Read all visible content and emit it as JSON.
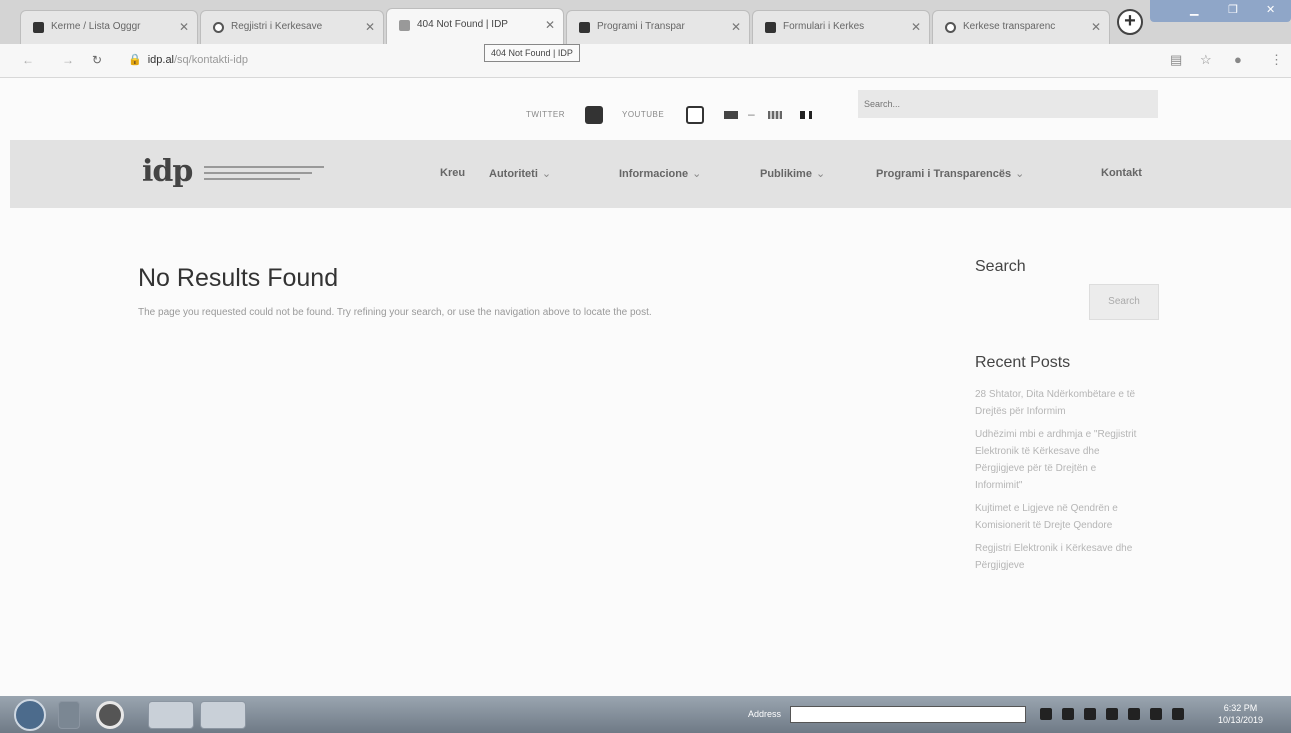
{
  "browser": {
    "tabs": [
      {
        "title": "Kerme / Lista Ogggr",
        "icon": "shield-icon"
      },
      {
        "title": "Regjistri i Kerkesave",
        "icon": "globe-icon"
      },
      {
        "title": "404 Not Found | IDP",
        "icon": "page-icon"
      },
      {
        "title": "Programi i Transpar",
        "icon": "shield-icon"
      },
      {
        "title": "Formulari i Kerkes",
        "icon": "shield-icon"
      },
      {
        "title": "Kerkese transparenc",
        "icon": "globe-icon"
      }
    ],
    "tooltip": "404 Not Found | IDP",
    "url_host": "idp.al",
    "url_path": "/sq/kontakti-idp",
    "new_tab": "+"
  },
  "site": {
    "social": {
      "twitter_label": "TWITTER",
      "youtube_label": "YOUTUBE"
    },
    "search_placeholder": "Search...",
    "nav": [
      {
        "label": "Kreu",
        "dropdown": false
      },
      {
        "label": "Autoriteti",
        "dropdown": true
      },
      {
        "label": "Informacione",
        "dropdown": true
      },
      {
        "label": "Publikime",
        "dropdown": true
      },
      {
        "label": "Programi i Transparencës",
        "dropdown": true
      },
      {
        "label": "Kontakt",
        "dropdown": false
      }
    ],
    "logo_text": "idp"
  },
  "main": {
    "heading": "No Results Found",
    "message": "The page you requested could not be found. Try refining your search, or use the navigation above to locate the post."
  },
  "sidebar": {
    "search_title": "Search",
    "search_button": "Search",
    "recent_title": "Recent Posts",
    "posts": [
      "28 Shtator, Dita Ndërkombëtare e të Drejtës për Informim",
      "Udhëzimi mbi e ardhmja e \"Regjistrit Elektronik të Kërkesave dhe Përgjigjeve për të Drejtën e Informimit\"",
      "Kujtimet e Ligjeve në Qendrën e Komisionerit të Drejte Qendore",
      "Regjistri Elektronik i Kërkesave dhe Përgjigjeve"
    ]
  },
  "taskbar": {
    "address_label": "Address",
    "time": "6:32 PM",
    "date": "10/13/2019"
  }
}
